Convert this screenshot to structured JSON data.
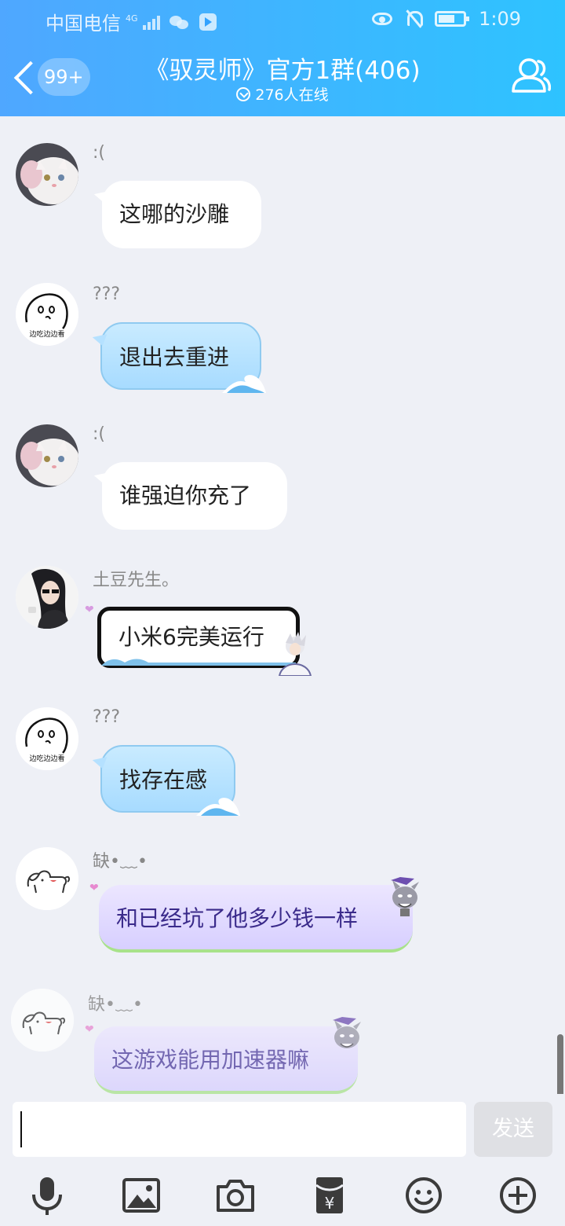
{
  "status_bar": {
    "carrier": "中国电信",
    "network": "4G",
    "time": "1:09"
  },
  "header": {
    "unread_count": "99+",
    "title": "《驭灵师》官方1群(406)",
    "online": "276人在线"
  },
  "messages": [
    {
      "sender": ":(",
      "text": "这哪的沙雕",
      "style": "white"
    },
    {
      "sender": "???",
      "text": "退出去重进",
      "style": "blue",
      "avatar_caption": "边吃边边看"
    },
    {
      "sender": ":(",
      "text": "谁强迫你充了",
      "style": "white"
    },
    {
      "sender": "土豆先生。",
      "text": "小米6完美运行",
      "style": "framed"
    },
    {
      "sender": "???",
      "text": "找存在感",
      "style": "blue",
      "avatar_caption": "边吃边边看"
    },
    {
      "sender": "缺•﹏•",
      "text": "和已经坑了他多少钱一样",
      "style": "lavender"
    },
    {
      "sender": "缺•﹏•",
      "text": "这游戏能用加速器嘛",
      "style": "lavender"
    }
  ],
  "composer": {
    "value": "",
    "send_label": "发送"
  },
  "toolbar": [
    "mic-icon",
    "image-icon",
    "camera-icon",
    "red-packet-icon",
    "emoji-icon",
    "plus-icon"
  ],
  "colors": {
    "header_start": "#4fa7ff",
    "header_end": "#2ec3ff",
    "background": "#eef0f6"
  }
}
